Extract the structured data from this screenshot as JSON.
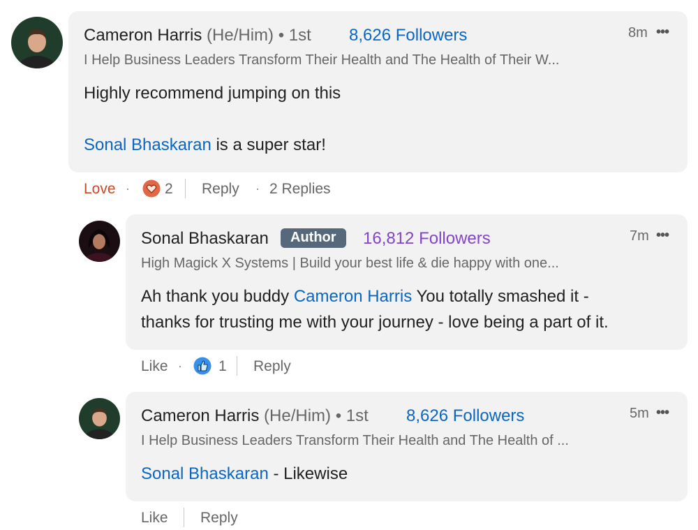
{
  "comments": [
    {
      "author": "Cameron Harris",
      "pronouns": "(He/Him)",
      "degree": "• 1st",
      "followers": "8,626 Followers",
      "headline": "I Help Business Leaders Transform Their Health and The Health of Their W...",
      "time": "8m",
      "more": "•••",
      "text_line1": "Highly recommend jumping on this",
      "mention": "Sonal Bhaskaran",
      "text_after_mention": " is a super star!",
      "reaction_label": "Love",
      "reaction_count": "2",
      "reply_label": "Reply",
      "replies_label": "2 Replies",
      "reaction_icon": "heart-icon",
      "reaction_color": "#c74b23"
    },
    {
      "author": "Sonal Bhaskaran",
      "badge": "Author",
      "followers": "16,812 Followers",
      "headline": "High Magick X Systems | Build your best life & die happy with one...",
      "time": "7m",
      "more": "•••",
      "text_before_mention": "Ah thank you buddy ",
      "mention": "Cameron Harris",
      "text_after_mention": " You totally smashed it -",
      "text_line2": "thanks for trusting me with your journey - love being a part of it.",
      "reaction_label": "Like",
      "reaction_count": "1",
      "reply_label": "Reply",
      "reaction_icon": "thumbs-up-icon"
    },
    {
      "author": "Cameron Harris",
      "pronouns": "(He/Him)",
      "degree": "• 1st",
      "followers": "8,626 Followers",
      "headline": "I Help Business Leaders Transform Their Health and The Health of ...",
      "time": "5m",
      "more": "•••",
      "mention": "Sonal Bhaskaran",
      "text_after_mention": " - Likewise",
      "reaction_label": "Like",
      "reply_label": "Reply"
    }
  ],
  "colors": {
    "link_blue": "#0a66c2",
    "author_followers_purple": "#8344cc",
    "bubble_bg": "#f2f2f2",
    "badge_bg": "#56687a",
    "love_color": "#c74b23"
  }
}
